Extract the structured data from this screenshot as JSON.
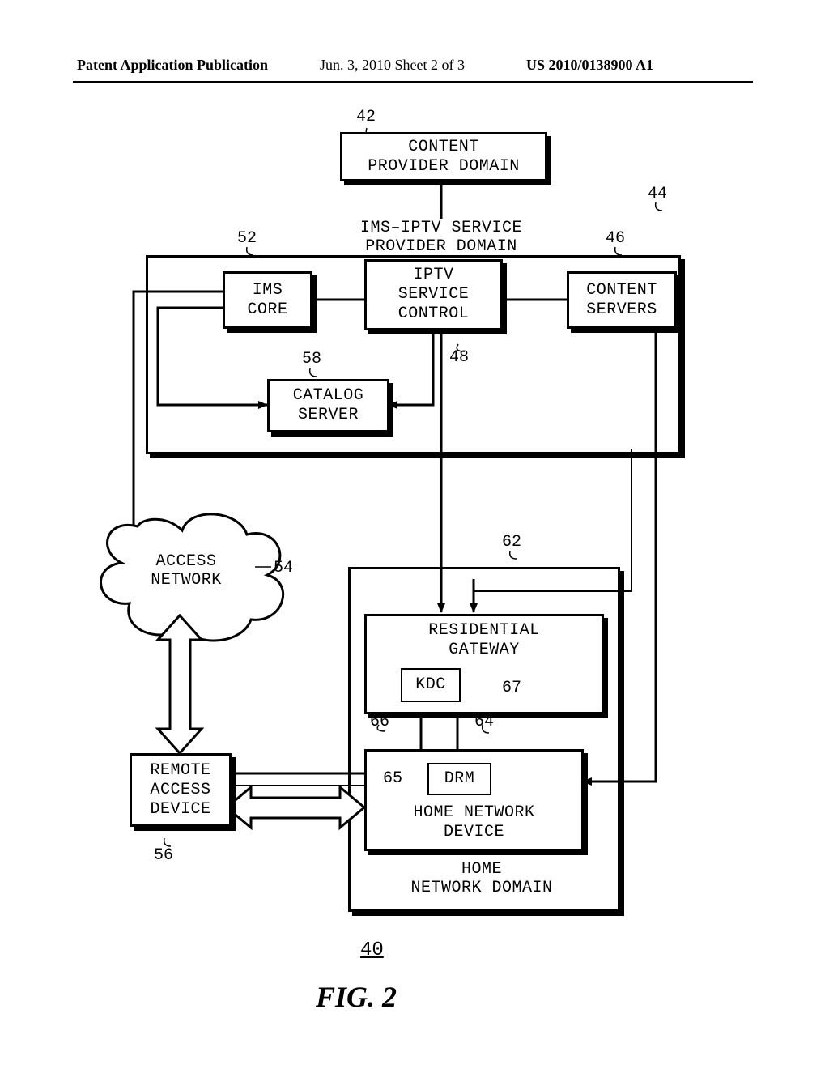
{
  "header": {
    "left": "Patent Application Publication",
    "middle": "Jun. 3, 2010  Sheet 2 of 3",
    "right": "US 2010/0138900 A1"
  },
  "refs": {
    "r40": "40",
    "r42": "42",
    "r44": "44",
    "r46": "46",
    "r48": "48",
    "r52": "52",
    "r54": "54",
    "r56": "56",
    "r58": "58",
    "r62": "62",
    "r64": "64",
    "r65": "65",
    "r66": "66",
    "r67": "67"
  },
  "blocks": {
    "content_provider_domain_l1": "CONTENT",
    "content_provider_domain_l2": "PROVIDER DOMAIN",
    "ims_iptv_l1": "IMS–IPTV SERVICE",
    "ims_iptv_l2": "PROVIDER DOMAIN",
    "ims_core_l1": "IMS",
    "ims_core_l2": "CORE",
    "iptv_svc_l1": "IPTV",
    "iptv_svc_l2": "SERVICE",
    "iptv_svc_l3": "CONTROL",
    "content_servers_l1": "CONTENT",
    "content_servers_l2": "SERVERS",
    "catalog_l1": "CATALOG",
    "catalog_l2": "SERVER",
    "access_network_l1": "ACCESS",
    "access_network_l2": "NETWORK",
    "res_gateway_l1": "RESIDENTIAL",
    "res_gateway_l2": "GATEWAY",
    "kdc": "KDC",
    "drm": "DRM",
    "home_net_dev_l1": "HOME NETWORK",
    "home_net_dev_l2": "DEVICE",
    "remote_access_l1": "REMOTE",
    "remote_access_l2": "ACCESS",
    "remote_access_l3": "DEVICE",
    "home_net_domain_l1": "HOME",
    "home_net_domain_l2": "NETWORK DOMAIN"
  },
  "figure": {
    "title": "FIG. 2"
  }
}
